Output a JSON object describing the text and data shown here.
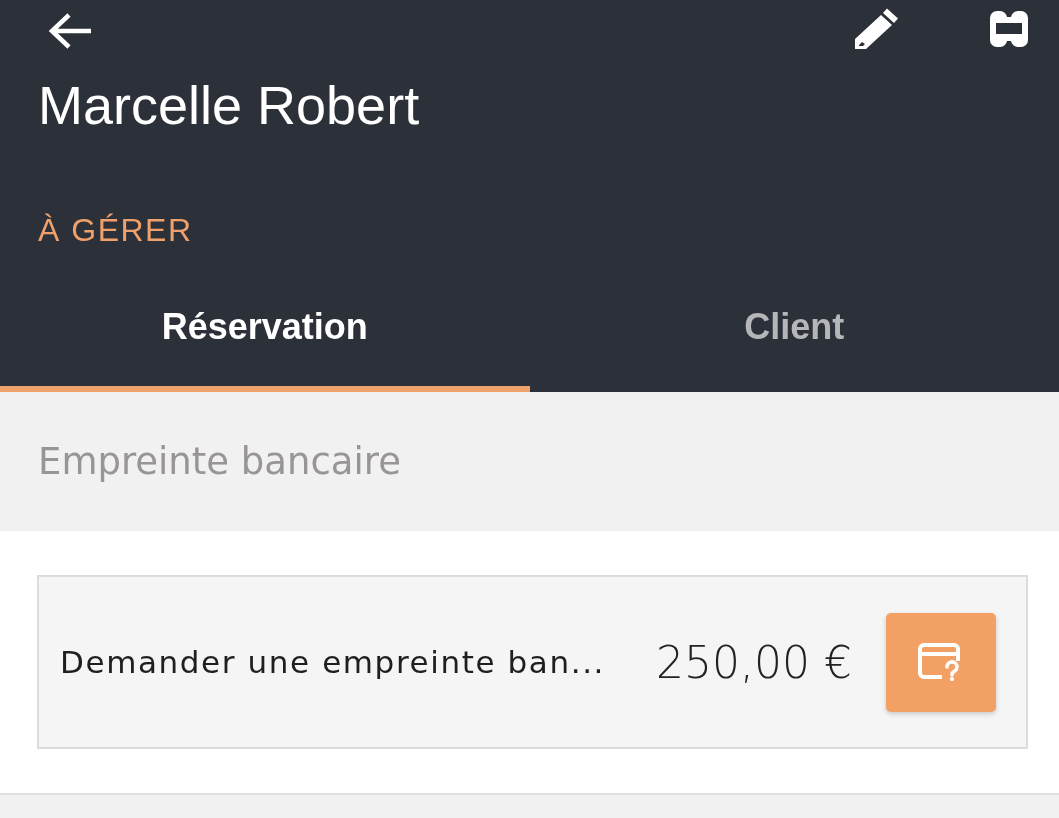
{
  "header": {
    "title": "Marcelle Robert",
    "status": "À GÉRER"
  },
  "tabs": [
    {
      "label": "Réservation",
      "selected": true
    },
    {
      "label": "Client",
      "selected": false
    }
  ],
  "section": {
    "title": "Empreinte bancaire"
  },
  "request_card": {
    "label": "Demander une empreinte ban...",
    "amount": "250,00 €"
  }
}
